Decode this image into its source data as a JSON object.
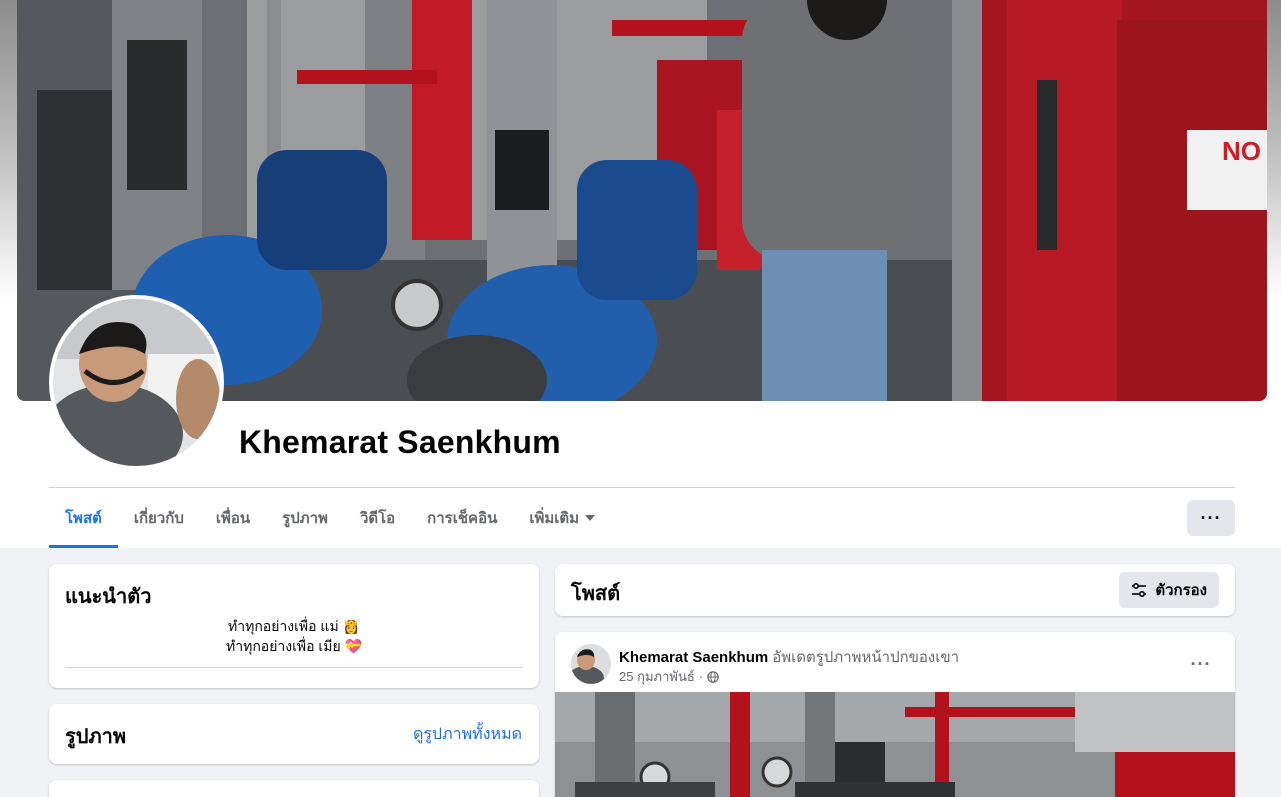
{
  "profile": {
    "name": "Khemarat Saenkhum"
  },
  "tabs": [
    {
      "label": "โพสต์",
      "active": true
    },
    {
      "label": "เกี่ยวกับ"
    },
    {
      "label": "เพื่อน"
    },
    {
      "label": "รูปภาพ"
    },
    {
      "label": "วิดีโอ"
    },
    {
      "label": "การเช็คอิน"
    },
    {
      "label": "เพิ่มเติม"
    }
  ],
  "more_button_label": "···",
  "intro": {
    "title": "แนะนำตัว",
    "bio_line_1": "ทำทุกอย่างเพื่อ แม่ 👸",
    "bio_line_2": "ทำทุกอย่างเพื่อ เมีย 💝"
  },
  "photos": {
    "title": "รูปภาพ",
    "see_all": "ดูรูปภาพทั้งหมด"
  },
  "posts": {
    "title": "โพสต์",
    "filter_label": "ตัวกรอง"
  },
  "post": {
    "author": "Khemarat Saenkhum",
    "action": "อัพเดตรูปภาพหน้าปกของเขา",
    "date": "25 กุมภาพันธ์",
    "separator": "·",
    "privacy_icon": "globe-icon",
    "menu_label": "···"
  },
  "colors": {
    "accent": "#1b74e4",
    "link": "#216fdb",
    "background": "#f0f2f5",
    "button_gray": "#e4e6eb",
    "fire_red": "#b3121c",
    "pump_blue": "#1e5fb0"
  }
}
